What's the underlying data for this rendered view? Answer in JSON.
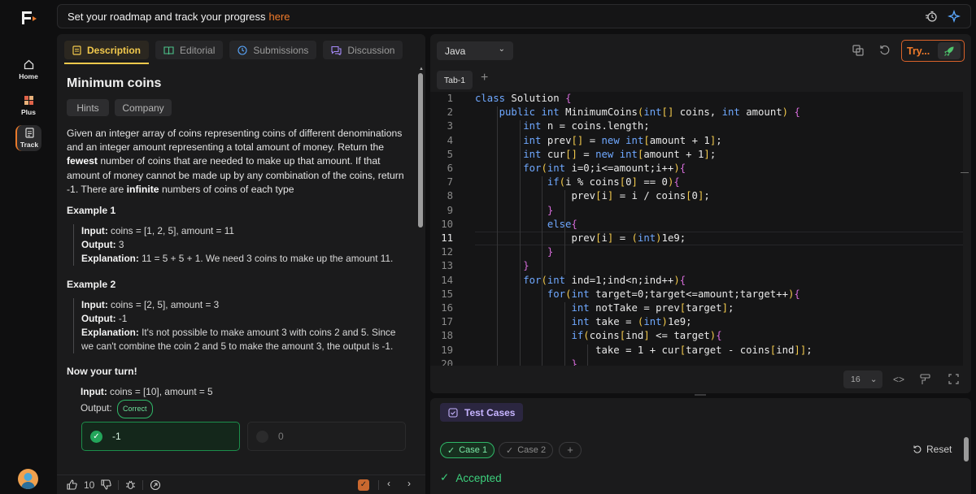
{
  "banner": {
    "text": "Set your roadmap and track your progress",
    "link": "here"
  },
  "rail": {
    "items": [
      {
        "label": "Home",
        "icon": "home-icon"
      },
      {
        "label": "Plus",
        "icon": "grid-icon"
      },
      {
        "label": "Track",
        "icon": "document-icon"
      }
    ]
  },
  "left": {
    "tabs": [
      {
        "label": "Description",
        "icon": "document-icon"
      },
      {
        "label": "Editorial",
        "icon": "book-icon"
      },
      {
        "label": "Submissions",
        "icon": "clock-icon"
      },
      {
        "label": "Discussion",
        "icon": "chat-icon"
      }
    ],
    "title": "Minimum coins",
    "pills": [
      "Hints",
      "Company"
    ],
    "description": {
      "p1": "Given an integer array of coins representing coins of different denominations and an integer amount representing a total amount of money. Return the ",
      "b1": "fewest",
      "p2": " number of coins that are needed to make up that amount. If that amount of money cannot be made up by any combination of the coins, return -1. There are ",
      "b2": "infinite",
      "p3": " numbers of coins of each type"
    },
    "examples": [
      {
        "heading": "Example 1",
        "input_label": "Input:",
        "input": " coins = [1, 2, 5], amount = 11",
        "output_label": "Output:",
        "output": " 3",
        "expl_label": "Explanation:",
        "expl": " 11 = 5 + 5 + 1. We need 3 coins to make up the amount 11."
      },
      {
        "heading": "Example 2",
        "input_label": "Input:",
        "input": " coins = [2, 5], amount = 3",
        "output_label": "Output:",
        "output": " -1",
        "expl_label": "Explanation:",
        "expl": " It's not possible to make amount 3 with coins 2 and 5. Since we can't combine the coin 2 and 5 to make the amount 3, the output is -1."
      }
    ],
    "turn": {
      "heading": "Now your turn!",
      "input_label": "Input:",
      "input": " coins = [10], amount = 5",
      "output_label": "Output:",
      "badge": "Correct",
      "options": [
        "-1",
        "0"
      ]
    },
    "footer": {
      "likes": "10"
    }
  },
  "editor": {
    "language": "Java",
    "try_label": "Try...",
    "tab": "Tab-1",
    "font_size": "16",
    "current_line": 11,
    "lines": [
      "class Solution {",
      "    public int MinimumCoins(int[] coins, int amount) {",
      "        int n = coins.length;",
      "        int prev[] = new int[amount + 1];",
      "        int cur[] = new int[amount + 1];",
      "        for(int i=0;i<=amount;i++){",
      "            if(i % coins[0] == 0){",
      "                prev[i] = i / coins[0];",
      "            }",
      "            else{",
      "                prev[i] = (int)1e9;",
      "            }",
      "        }",
      "        for(int ind=1;ind<n;ind++){",
      "            for(int target=0;target<=amount;target++){",
      "                int notTake = prev[target];",
      "                int take = (int)1e9;",
      "                if(coins[ind] <= target){",
      "                    take = 1 + cur[target - coins[ind]];",
      "                }"
    ]
  },
  "tests": {
    "title": "Test Cases",
    "cases": [
      "Case 1",
      "Case 2"
    ],
    "reset": "Reset",
    "status": "Accepted"
  },
  "colors": {
    "accent": "#f07a2a",
    "success": "#2fb868",
    "tab_active": "#f2c94c"
  }
}
